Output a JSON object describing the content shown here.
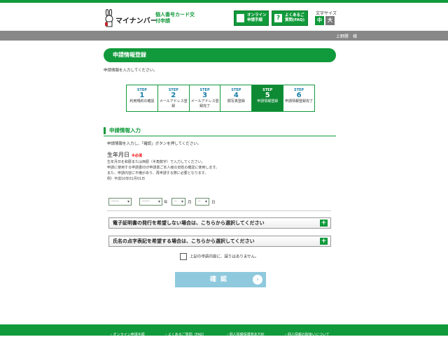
{
  "header": {
    "logo_text": "マイナンバー",
    "doc_title": "個人番号カード交付申請",
    "online_btn": "オンライン申請手順",
    "faq_btn": "よくあるご質問(FAQ)",
    "faq_icon": "?",
    "fontsize_label": "文字サイズ",
    "fontsize_mid": "中",
    "fontsize_large": "大"
  },
  "userbar": {
    "user": "上野勝　様"
  },
  "main": {
    "title": "申請情報登録",
    "intro": "申請情報を入力してください。",
    "steps": [
      {
        "label": "STEP",
        "num": "1",
        "name": "利用規約の確認"
      },
      {
        "label": "STEP",
        "num": "2",
        "name": "メールアドレス登録"
      },
      {
        "label": "STEP",
        "num": "3",
        "name": "メールアドレス登録完了"
      },
      {
        "label": "STEP",
        "num": "4",
        "name": "顔写真登録"
      },
      {
        "label": "STEP",
        "num": "5",
        "name": "申請情報登録"
      },
      {
        "label": "STEP",
        "num": "6",
        "name": "申請情報登録完了"
      }
    ],
    "section": "申請情報入力",
    "instruction": "申請情報を入力し、「確認」ボタンを押してください。",
    "dob_label": "生年月日",
    "required": "※必須",
    "notes": [
      "生年月日を和暦または西暦（半角数字）で入力してください。",
      "申請に使用する申請書IDが申請書ご本人様の旧姓の確認に使用します。",
      "また、申請内容に不備があり、再申請する際に必要となります。",
      "例）平成10年01月01日"
    ],
    "era_select": "------",
    "year_select": "------",
    "year_unit": "年",
    "month_select": "--",
    "month_unit": "月",
    "day_select": "--",
    "day_unit": "日",
    "accordion1": "電子証明書の発行を希望しない場合は、こちらから選択してください",
    "accordion2": "氏名の点字表記を希望する場合は、こちらから選択してください",
    "plus": "+",
    "confirm_check": "上記の申請内容に、誤りはありません。",
    "submit": "確認",
    "submit_arrow": "›"
  },
  "footer": {
    "links": [
      "オンライン申請手順",
      "よくあるご質問（FAQ）",
      "個人情報保護基本方針",
      "個人情報の取扱いについて"
    ]
  }
}
